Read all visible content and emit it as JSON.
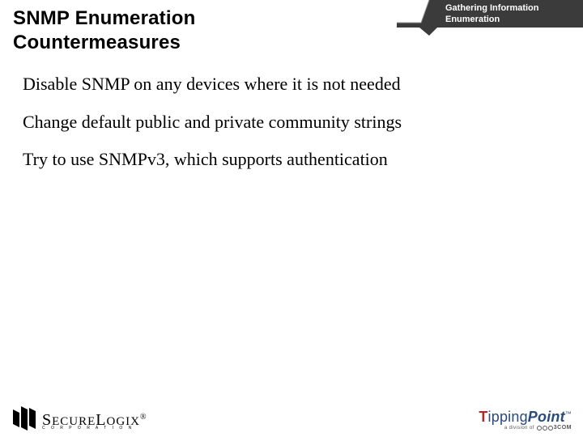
{
  "header": {
    "title_line1": "SNMP Enumeration",
    "title_line2": "Countermeasures",
    "tag_line1": "Gathering Information",
    "tag_line2": "Enumeration"
  },
  "bullets": [
    "Disable SNMP on any devices where it is not needed",
    "Change default public and private community strings",
    "Try to use SNMPv3, which supports authentication"
  ],
  "footer": {
    "left": {
      "main_1": "S",
      "main_2": "ECURE",
      "main_3": "L",
      "main_4": "OGIX",
      "reg": "®",
      "sub": "C O R P O R A T I O N"
    },
    "right": {
      "t": "T",
      "ipping": "ipping",
      "point": "Point",
      "tm": "™",
      "sub_text": "a division of",
      "threecom": "3COM"
    }
  },
  "colors": {
    "tag_fill": "#3b3b3b",
    "tag_stroke": "#8a8a8a"
  }
}
